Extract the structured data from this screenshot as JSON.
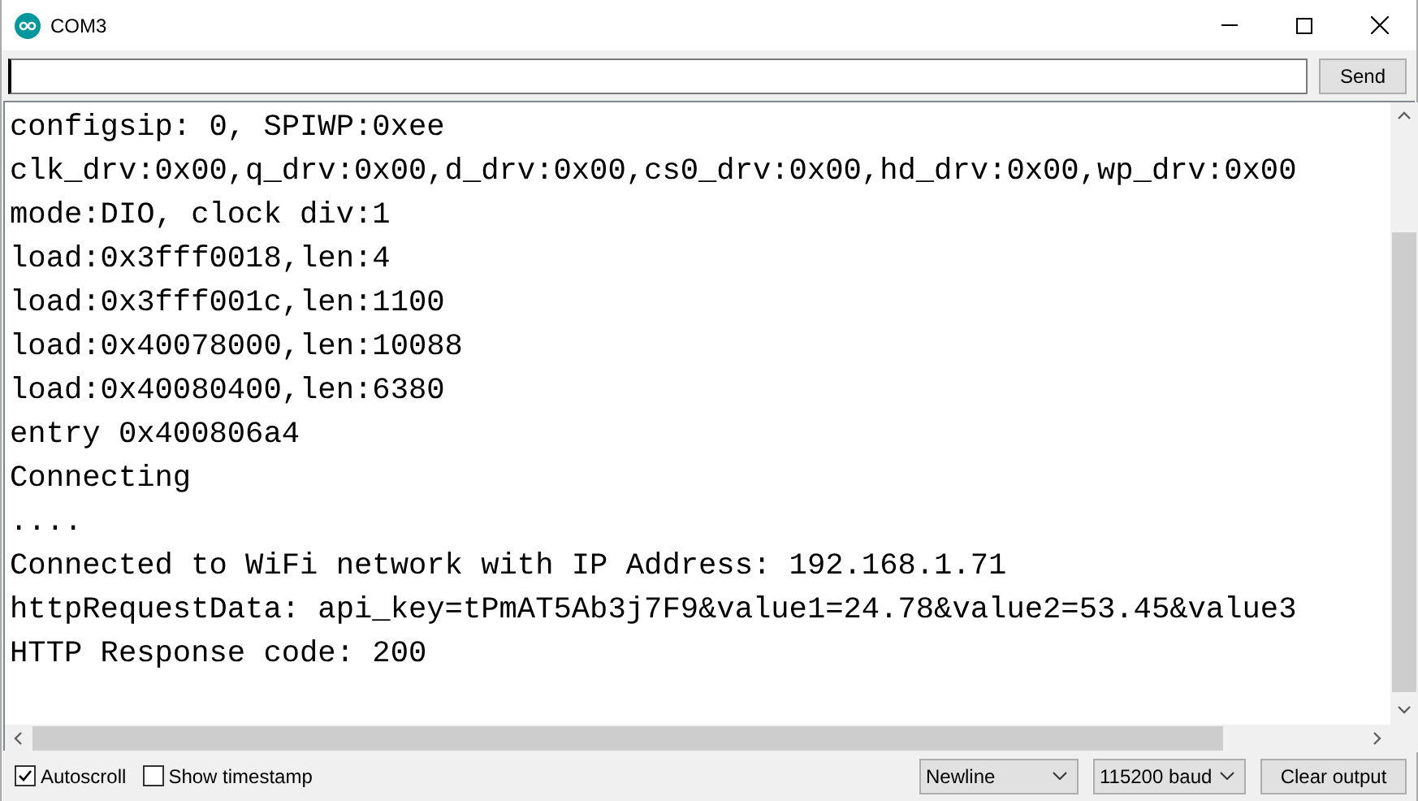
{
  "window": {
    "title": "COM3"
  },
  "send_button": "Send",
  "output_lines": [
    "configsip: 0, SPIWP:0xee",
    "clk_drv:0x00,q_drv:0x00,d_drv:0x00,cs0_drv:0x00,hd_drv:0x00,wp_drv:0x00",
    "mode:DIO, clock div:1",
    "load:0x3fff0018,len:4",
    "load:0x3fff001c,len:1100",
    "load:0x40078000,len:10088",
    "load:0x40080400,len:6380",
    "entry 0x400806a4",
    "Connecting",
    "....",
    "Connected to WiFi network with IP Address: 192.168.1.71",
    "httpRequestData: api_key=tPmAT5Ab3j7F9&value1=24.78&value2=53.45&value3",
    "HTTP Response code: 200"
  ],
  "options": [
    {
      "label": "Autoscroll",
      "checked": true
    },
    {
      "label": "Show timestamp",
      "checked": false
    }
  ],
  "dropdowns": [
    {
      "value": "Newline"
    },
    {
      "value": "115200 baud"
    }
  ],
  "clear_button": "Clear output"
}
